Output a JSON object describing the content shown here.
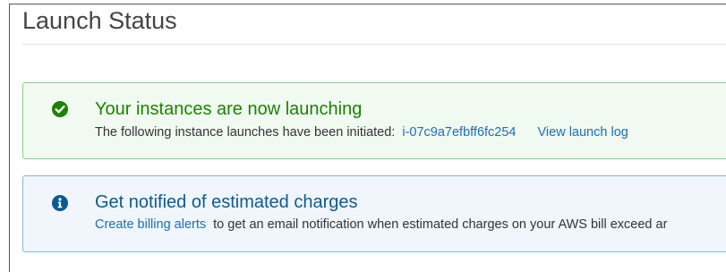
{
  "page": {
    "title": "Launch Status"
  },
  "success_alert": {
    "icon": "check-circle-icon",
    "color": "#1d8102",
    "heading": "Your instances are now launching",
    "body_text": "The following instance launches have been initiated:",
    "instance_id": "i-07c9a7efbff6fc254",
    "log_link": "View launch log"
  },
  "info_alert": {
    "icon": "info-circle-icon",
    "color": "#0b5a93",
    "heading": "Get notified of estimated charges",
    "link": "Create billing alerts",
    "body_text": "to get an email notification when estimated charges on your AWS bill exceed ar"
  }
}
